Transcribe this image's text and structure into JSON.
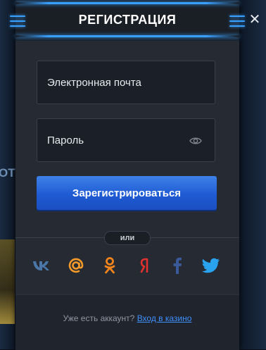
{
  "modal": {
    "title": "РЕГИСТРАЦИЯ",
    "close_icon": "close-icon"
  },
  "form": {
    "email_placeholder": "Электронная почта",
    "password_placeholder": "Пароль",
    "submit_label": "Зарегистрироваться"
  },
  "divider": {
    "label": "или"
  },
  "social": [
    {
      "name": "vk",
      "icon": "vk-icon",
      "color": "#4a76a8"
    },
    {
      "name": "mail",
      "icon": "mail-ru-icon",
      "color": "#f59a2a"
    },
    {
      "name": "ok",
      "icon": "odnoklassniki-icon",
      "color": "#f2841c"
    },
    {
      "name": "yandex",
      "icon": "yandex-icon",
      "color": "#e0322f"
    },
    {
      "name": "facebook",
      "icon": "facebook-icon",
      "color": "#3b5998"
    },
    {
      "name": "twitter",
      "icon": "twitter-icon",
      "color": "#2aa3ef"
    }
  ],
  "footer": {
    "question": "Уже есть аккаунт?",
    "login_link": "Вход в казино"
  },
  "background": {
    "peek_text": "ОТ"
  },
  "colors": {
    "accent": "#3aa0ff",
    "button": "#2563d8",
    "panel": "#252a33",
    "link": "#3f8fff"
  }
}
